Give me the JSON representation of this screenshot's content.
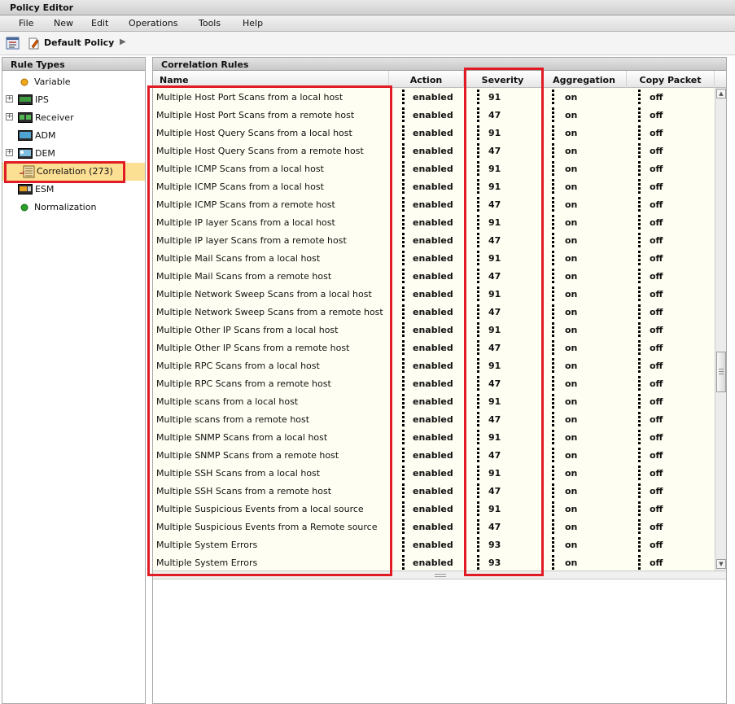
{
  "window": {
    "title": "Policy Editor"
  },
  "menu": [
    "File",
    "New",
    "Edit",
    "Operations",
    "Tools",
    "Help"
  ],
  "toolbar": {
    "policy_name": "Default Policy",
    "arrow": "▶"
  },
  "left_pane": {
    "header": "Rule Types",
    "items": [
      {
        "label": "Variable",
        "icon": "variable-dot-icon",
        "expandable": false,
        "selected": false
      },
      {
        "label": "IPS",
        "icon": "ips-device-icon",
        "expandable": true,
        "selected": false
      },
      {
        "label": "Receiver",
        "icon": "receiver-device-icon",
        "expandable": true,
        "selected": false
      },
      {
        "label": "ADM",
        "icon": "adm-device-icon",
        "expandable": false,
        "selected": false
      },
      {
        "label": "DEM",
        "icon": "dem-device-icon",
        "expandable": true,
        "selected": false
      },
      {
        "label": "Correlation (273)",
        "icon": "correlation-icon",
        "expandable": false,
        "selected": true
      },
      {
        "label": "ESM",
        "icon": "esm-device-icon",
        "expandable": false,
        "selected": false
      },
      {
        "label": "Normalization",
        "icon": "normalization-dot-icon",
        "expandable": false,
        "selected": false
      }
    ]
  },
  "right_pane": {
    "header": "Correlation Rules",
    "columns": [
      "Name",
      "Action",
      "Severity",
      "Aggregation",
      "Copy Packet"
    ],
    "rows": [
      [
        "Multiple Host Port Scans from a local host",
        "enabled",
        "91",
        "on",
        "off"
      ],
      [
        "Multiple Host Port Scans from a remote host",
        "enabled",
        "47",
        "on",
        "off"
      ],
      [
        "Multiple Host Query Scans from a local host",
        "enabled",
        "91",
        "on",
        "off"
      ],
      [
        "Multiple Host Query Scans from a remote host",
        "enabled",
        "47",
        "on",
        "off"
      ],
      [
        "Multiple ICMP Scans from a local host",
        "enabled",
        "91",
        "on",
        "off"
      ],
      [
        "Multiple ICMP Scans from a local host",
        "enabled",
        "91",
        "on",
        "off"
      ],
      [
        "Multiple ICMP Scans from a remote host",
        "enabled",
        "47",
        "on",
        "off"
      ],
      [
        "Multiple IP layer Scans from a local host",
        "enabled",
        "91",
        "on",
        "off"
      ],
      [
        "Multiple IP layer Scans from a remote host",
        "enabled",
        "47",
        "on",
        "off"
      ],
      [
        "Multiple Mail Scans from a local host",
        "enabled",
        "91",
        "on",
        "off"
      ],
      [
        "Multiple Mail Scans from a remote host",
        "enabled",
        "47",
        "on",
        "off"
      ],
      [
        "Multiple Network Sweep Scans from a local host",
        "enabled",
        "91",
        "on",
        "off"
      ],
      [
        "Multiple Network Sweep Scans from a remote host",
        "enabled",
        "47",
        "on",
        "off"
      ],
      [
        "Multiple Other IP Scans from a local host",
        "enabled",
        "91",
        "on",
        "off"
      ],
      [
        "Multiple Other IP Scans from a remote host",
        "enabled",
        "47",
        "on",
        "off"
      ],
      [
        "Multiple RPC Scans from a local host",
        "enabled",
        "91",
        "on",
        "off"
      ],
      [
        "Multiple RPC Scans from a remote host",
        "enabled",
        "47",
        "on",
        "off"
      ],
      [
        "Multiple scans from a local host",
        "enabled",
        "91",
        "on",
        "off"
      ],
      [
        "Multiple scans from a remote host",
        "enabled",
        "47",
        "on",
        "off"
      ],
      [
        "Multiple SNMP Scans from a local host",
        "enabled",
        "91",
        "on",
        "off"
      ],
      [
        "Multiple SNMP Scans from a remote host",
        "enabled",
        "47",
        "on",
        "off"
      ],
      [
        "Multiple SSH Scans from a local host",
        "enabled",
        "91",
        "on",
        "off"
      ],
      [
        "Multiple SSH Scans from a remote host",
        "enabled",
        "47",
        "on",
        "off"
      ],
      [
        "Multiple Suspicious Events from a local source",
        "enabled",
        "91",
        "on",
        "off"
      ],
      [
        "Multiple Suspicious Events from a Remote source",
        "enabled",
        "47",
        "on",
        "off"
      ],
      [
        "Multiple System Errors",
        "enabled",
        "93",
        "on",
        "off"
      ],
      [
        "Multiple System Errors",
        "enabled",
        "93",
        "on",
        "off"
      ]
    ]
  },
  "colors": {
    "selected_bg": "#fbdf93",
    "grid_bg": "#fffef2",
    "highlight": "#e01b24"
  }
}
